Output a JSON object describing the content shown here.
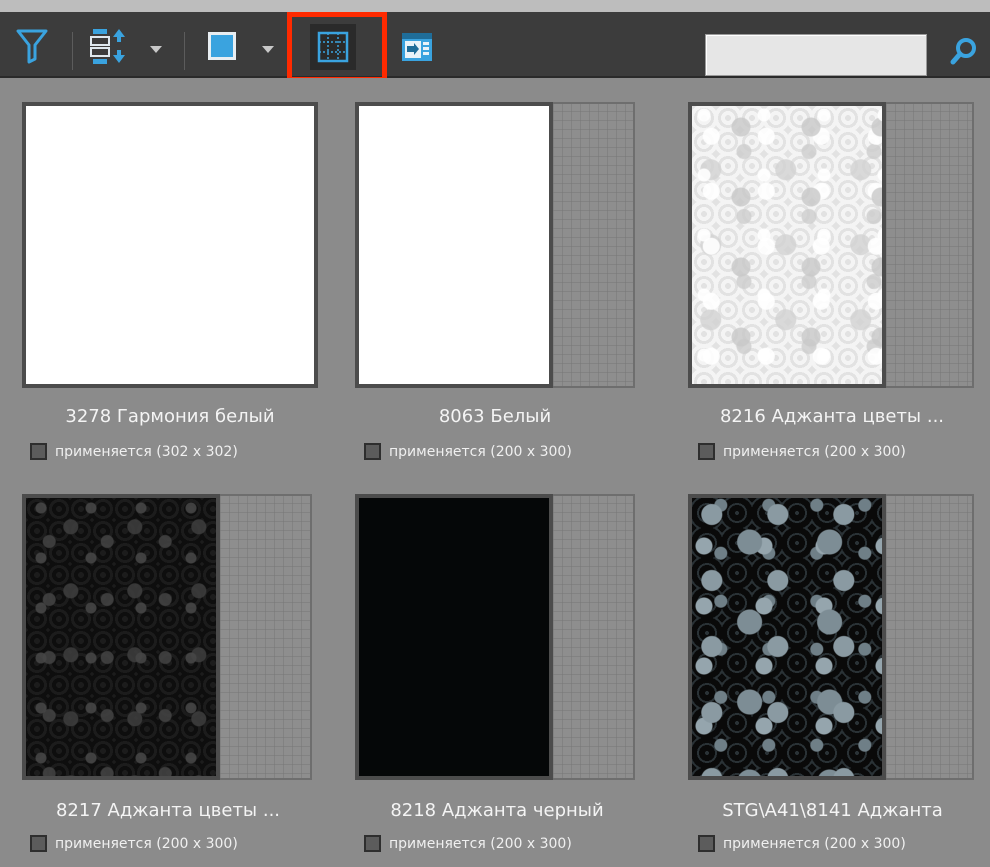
{
  "toolbar": {
    "icons": {
      "filter": "filter-icon",
      "sort": "sort-icon",
      "view_mode": "square-view-icon",
      "grid": "grid-view-icon",
      "panel": "panel-toggle-icon",
      "search": "search-icon"
    },
    "search_value": "",
    "accent": "#3aa3df",
    "highlight": "#ff2a00"
  },
  "items": [
    {
      "title": "3278 Гармония белый",
      "status": "применяется (302 x 302)",
      "texture": "white"
    },
    {
      "title": "8063 Белый",
      "status": "применяется (200 x 300)",
      "texture": "white"
    },
    {
      "title": "8216 Аджанта цветы ...",
      "status": "применяется (200 x 300)",
      "texture": "white-floral"
    },
    {
      "title": "8217 Аджанта цветы ...",
      "status": "применяется (200 x 300)",
      "texture": "black-floral"
    },
    {
      "title": "8218 Аджанта черный",
      "status": "применяется (200 x 300)",
      "texture": "black"
    },
    {
      "title": "STG\\A41\\8141 Аджанта",
      "status": "применяется (200 x 300)",
      "texture": "black-grey-floral"
    }
  ]
}
